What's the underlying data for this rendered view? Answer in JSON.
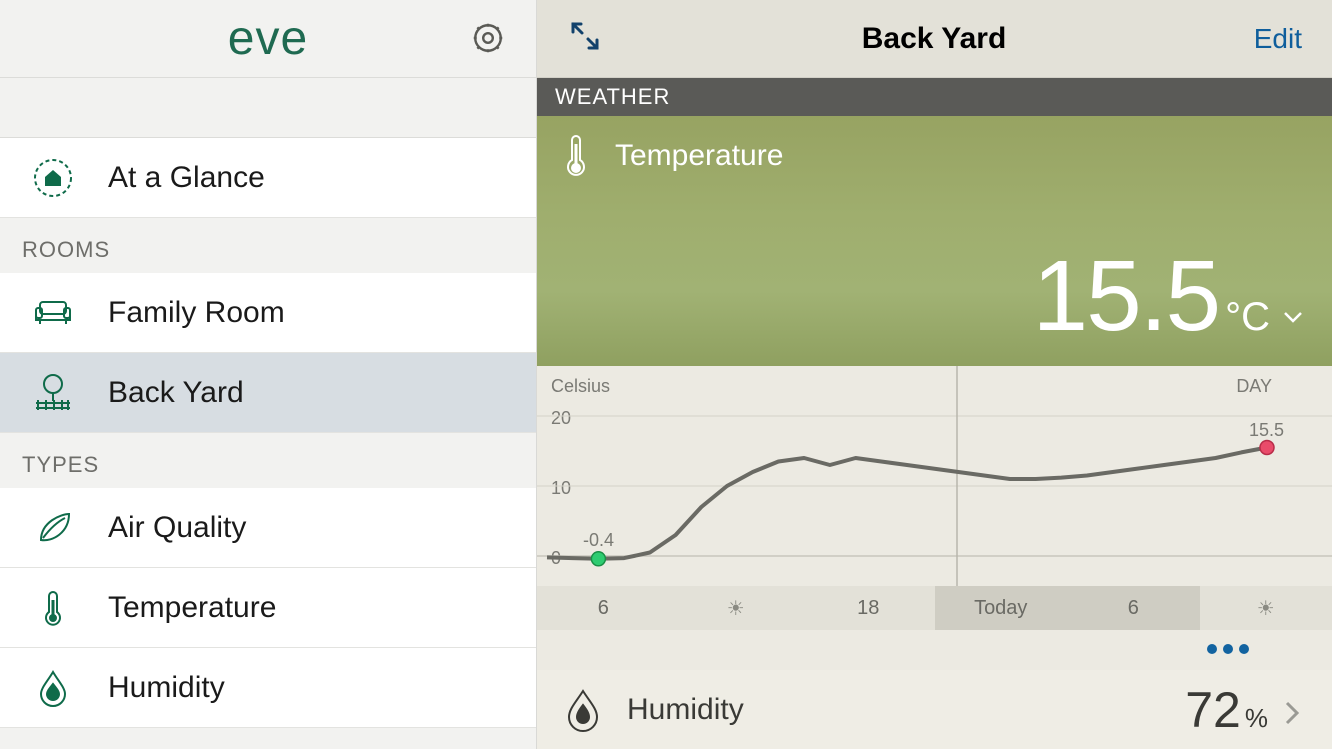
{
  "brand": "eve",
  "sidebar": {
    "at_glance": "At a Glance",
    "rooms_header": "ROOMS",
    "types_header": "TYPES",
    "rooms": [
      {
        "label": "Family Room",
        "icon": "sofa-icon"
      },
      {
        "label": "Back Yard",
        "icon": "tree-fence-icon"
      }
    ],
    "types": [
      {
        "label": "Air Quality",
        "icon": "leaf-icon"
      },
      {
        "label": "Temperature",
        "icon": "thermometer-icon"
      },
      {
        "label": "Humidity",
        "icon": "droplet-icon"
      }
    ]
  },
  "main": {
    "title": "Back Yard",
    "edit": "Edit",
    "weather_section": "WEATHER",
    "temperature": {
      "label": "Temperature",
      "value": "15.5",
      "unit": "°C"
    },
    "humidity": {
      "label": "Humidity",
      "value": "72",
      "unit": "%"
    }
  },
  "chart_data": {
    "type": "line",
    "title": "Temperature",
    "ylabel": "Celsius",
    "range_label": "DAY",
    "ylim": [
      0,
      20
    ],
    "yticks": [
      0,
      10,
      20
    ],
    "x": [
      0,
      1,
      2,
      3,
      4,
      5,
      6,
      7,
      8,
      9,
      10,
      11,
      12,
      13,
      14,
      15,
      16,
      17,
      18,
      19,
      20,
      21,
      22,
      23,
      24,
      25,
      26,
      27,
      28
    ],
    "values": [
      -0.2,
      -0.3,
      -0.4,
      -0.3,
      0.5,
      3,
      7,
      10,
      12,
      13.5,
      14,
      13,
      14,
      13.5,
      13,
      12.5,
      12,
      11.5,
      11,
      11,
      11.2,
      11.5,
      12,
      12.5,
      13,
      13.5,
      14,
      14.8,
      15.5
    ],
    "min_marker": {
      "index": 2,
      "value": -0.4
    },
    "end_marker": {
      "index": 28,
      "value": 15.5
    },
    "timeline": [
      "6",
      "sun",
      "18",
      "Today",
      "6",
      "sun"
    ],
    "timeline_shaded": [
      false,
      false,
      false,
      true,
      true,
      false
    ]
  },
  "colors": {
    "accent": "#0f6b4a",
    "link": "#0f5e9c",
    "line": "#6a6a64",
    "min_dot": "#2ecc71",
    "end_dot": "#e94b6a"
  }
}
